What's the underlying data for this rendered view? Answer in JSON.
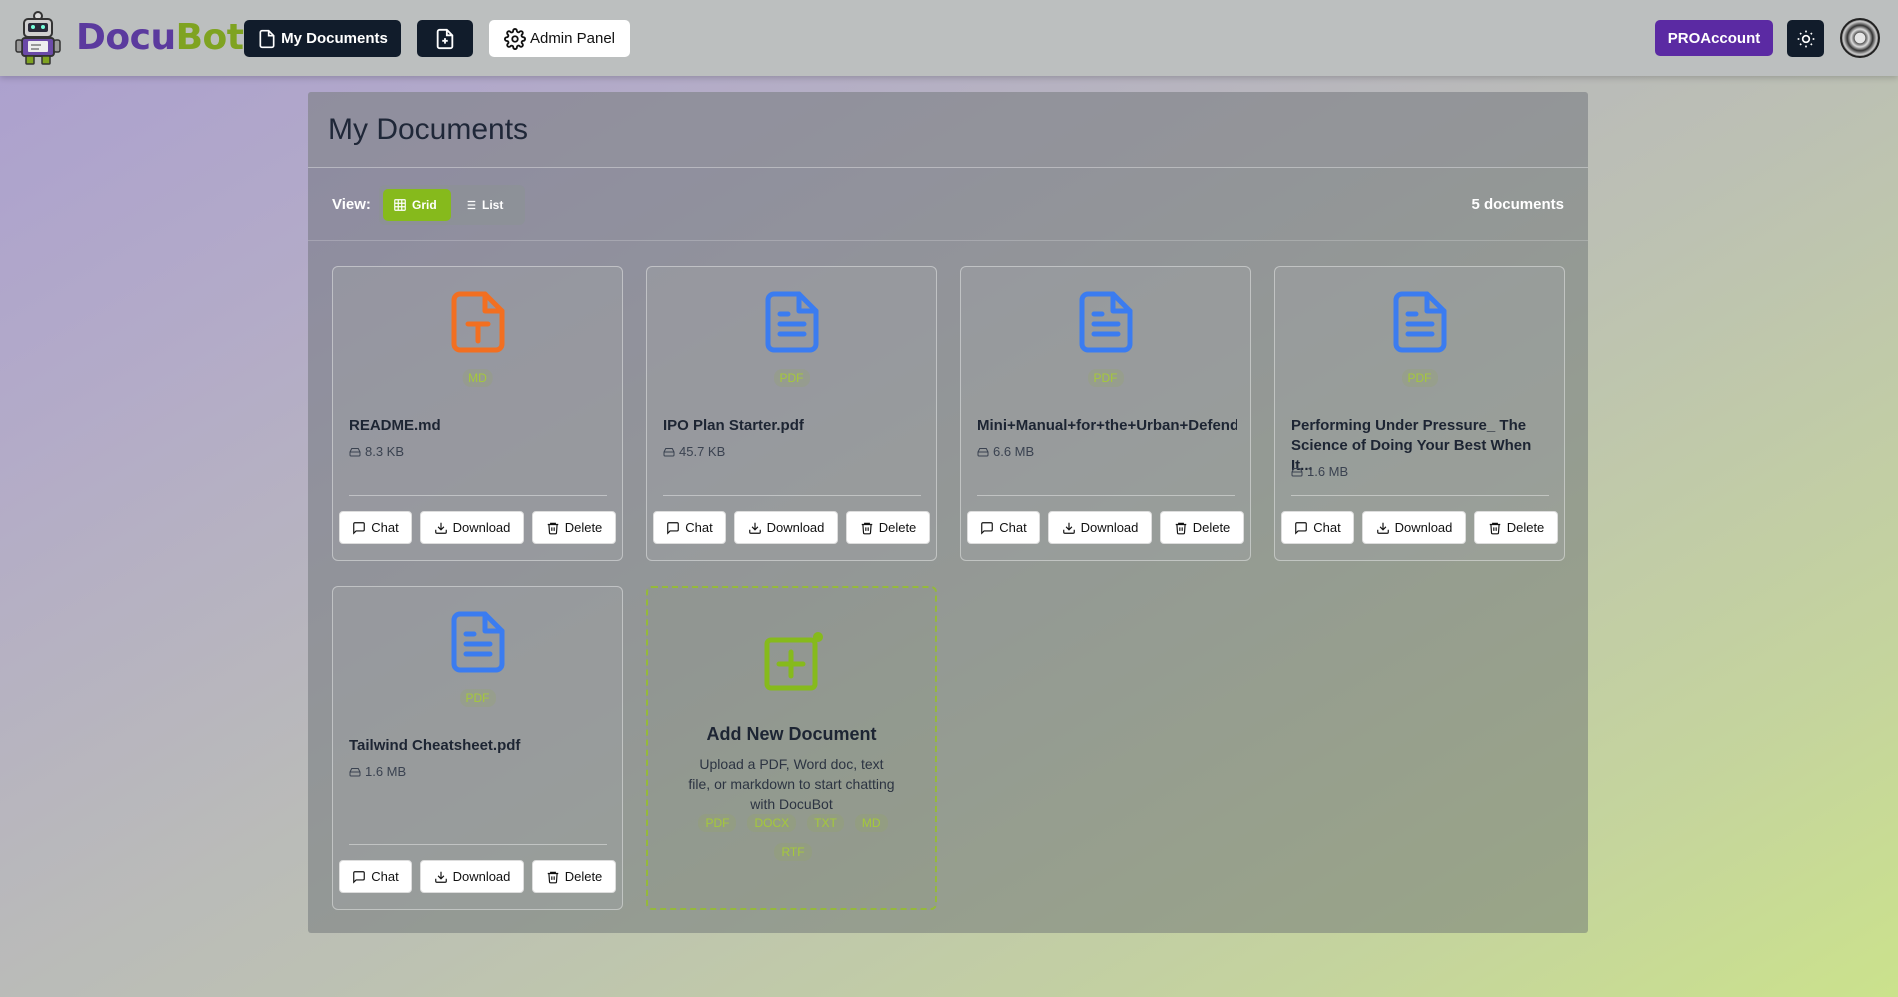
{
  "brand": {
    "part1": "Docu",
    "part2": "Bot"
  },
  "nav": {
    "my_documents": "My Documents",
    "admin_panel": "Admin Panel",
    "pro": "PRO",
    "account": "Account"
  },
  "page": {
    "title": "My Documents",
    "view_label": "View:",
    "view_grid": "Grid",
    "view_list": "List",
    "doc_count": "5 documents"
  },
  "documents": [
    {
      "name": "README.md",
      "size": "8.3 KB",
      "type": "MD",
      "icon": "text-file-icon"
    },
    {
      "name": "IPO Plan Starter.pdf",
      "size": "45.7 KB",
      "type": "PDF",
      "icon": "document-icon"
    },
    {
      "name": "Mini+Manual+for+the+Urban+Defend",
      "size": "6.6 MB",
      "type": "PDF",
      "icon": "document-icon"
    },
    {
      "name": "Performing Under Pressure_ The Science of Doing Your Best When It...",
      "size": "1.6 MB",
      "type": "PDF",
      "icon": "document-icon"
    },
    {
      "name": "Tailwind Cheatsheet.pdf",
      "size": "1.6 MB",
      "type": "PDF",
      "icon": "document-icon"
    }
  ],
  "actions": {
    "chat": "Chat",
    "download": "Download",
    "delete": "Delete"
  },
  "add_card": {
    "title": "Add New Document",
    "description": "Upload a PDF, Word doc, text file, or markdown to start chatting with DocuBot",
    "formats": [
      "PDF",
      "DOCX",
      "TXT",
      "MD",
      "RTF"
    ]
  },
  "colors": {
    "accent_green": "#86ba1c",
    "brand_purple": "#5b3a9e",
    "pro_purple": "#5b2aa3",
    "dark_navy": "#111c2b",
    "md_orange": "#f26f21",
    "pdf_blue": "#3b7cf0"
  }
}
